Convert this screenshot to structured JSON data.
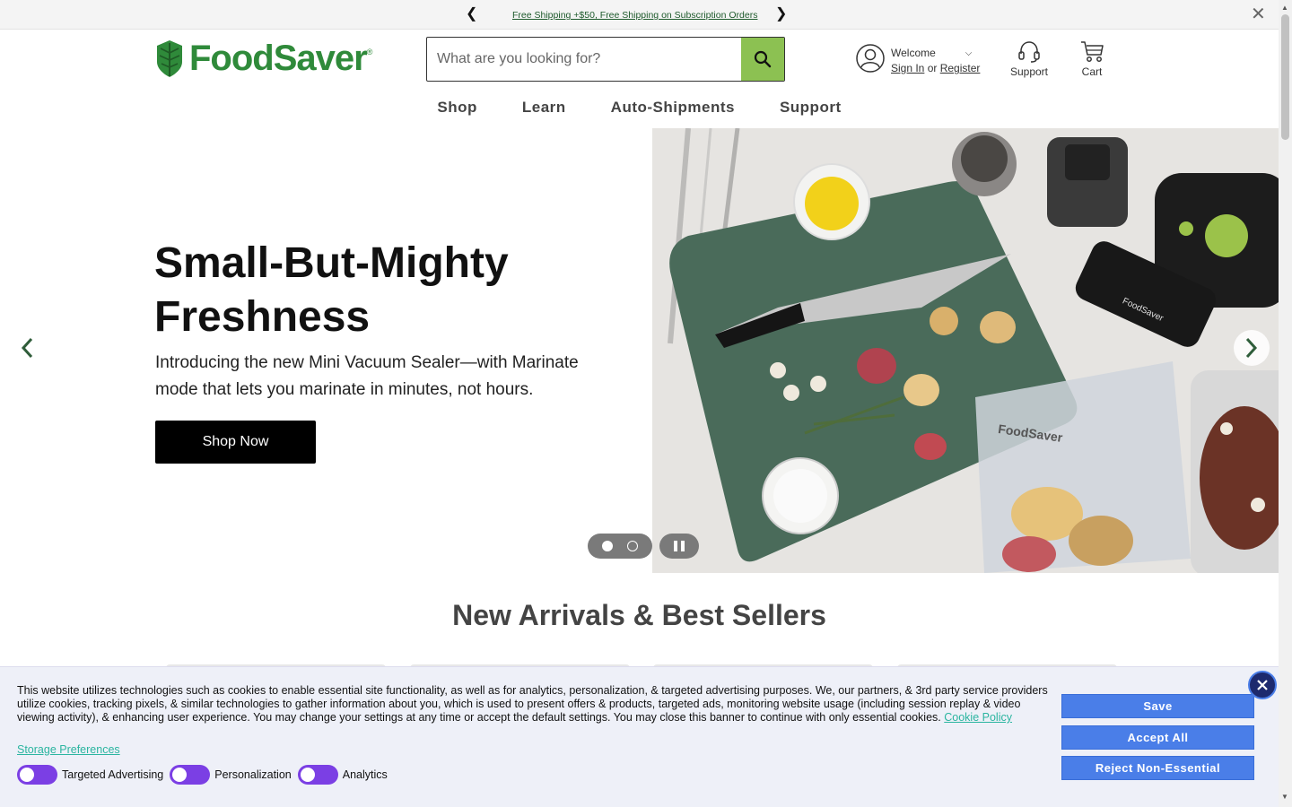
{
  "announcement": {
    "message": "Free Shipping +$50, Free Shipping on Subscription Orders",
    "prev_icon": "chevron-left-icon",
    "next_icon": "chevron-right-icon",
    "close_icon": "close-icon"
  },
  "header": {
    "logo_text": "FoodSaver",
    "logo_mark": "®",
    "search_placeholder": "What are you looking for?",
    "welcome": "Welcome",
    "sign_in": "Sign In",
    "or": "or",
    "register": "Register",
    "support": "Support",
    "cart": "Cart"
  },
  "nav": {
    "items": [
      "Shop",
      "Learn",
      "Auto-Shipments",
      "Support"
    ]
  },
  "hero": {
    "title_line1": "Small-But-Mighty",
    "title_line2": "Freshness",
    "subtitle": "Introducing the new Mini Vacuum Sealer—with Marinate mode that lets you marinate in minutes, not hours.",
    "cta": "Shop Now",
    "bag_brand": "FoodSaver",
    "sealer_brand": "FoodSaver",
    "slide_count": 2,
    "active_slide": 1
  },
  "section": {
    "title": "New Arrivals & Best Sellers"
  },
  "cookie": {
    "text": "This website utilizes technologies such as cookies to enable essential site functionality, as well as for analytics, personalization, & targeted advertising purposes. We, our partners, & 3rd party service providers utilize cookies, tracking pixels, & similar technologies to gather information about you, which is used to present offers & products, targeted ads, monitoring website usage (including session replay & video viewing activity), & enhancing user experience. You may change your settings at any time or accept the default settings. You may close this banner to continue with only essential cookies.",
    "policy_link": "Cookie Policy",
    "storage_prefs": "Storage Preferences",
    "toggles": [
      "Targeted Advertising",
      "Personalization",
      "Analytics"
    ],
    "save": "Save",
    "accept_all": "Accept All",
    "reject": "Reject Non-Essential"
  },
  "colors": {
    "brand_green": "#2f8a3a",
    "search_button": "#8cc152",
    "cookie_button": "#4a7ee8",
    "toggle_on": "#7b3fe4"
  }
}
